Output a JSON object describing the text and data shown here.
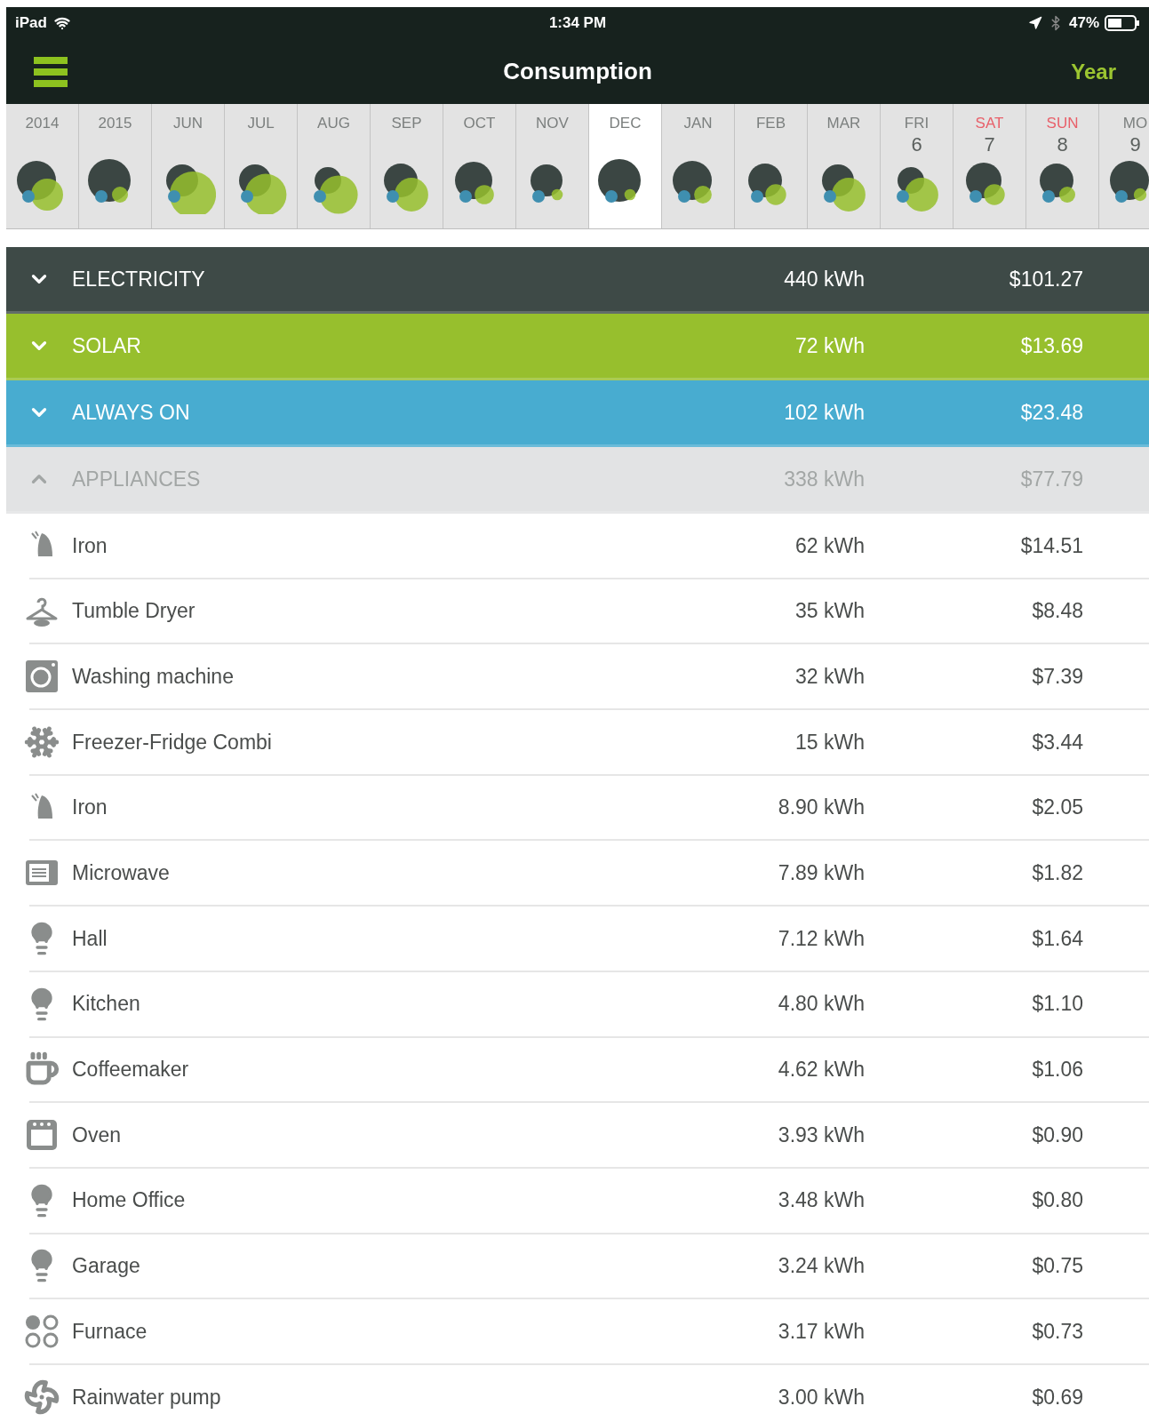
{
  "status_bar": {
    "device": "iPad",
    "time": "1:34 PM",
    "battery": "47%"
  },
  "header": {
    "title": "Consumption",
    "period": "Year"
  },
  "timeline": [
    {
      "label": "2014",
      "selected": false,
      "weekend": false
    },
    {
      "label": "2015",
      "selected": false,
      "weekend": false
    },
    {
      "label": "JUN",
      "selected": false,
      "weekend": false
    },
    {
      "label": "JUL",
      "selected": false,
      "weekend": false
    },
    {
      "label": "AUG",
      "selected": false,
      "weekend": false
    },
    {
      "label": "SEP",
      "selected": false,
      "weekend": false
    },
    {
      "label": "OCT",
      "selected": false,
      "weekend": false
    },
    {
      "label": "NOV",
      "selected": false,
      "weekend": false
    },
    {
      "label": "DEC",
      "selected": true,
      "weekend": false
    },
    {
      "label": "JAN",
      "selected": false,
      "weekend": false
    },
    {
      "label": "FEB",
      "selected": false,
      "weekend": false
    },
    {
      "label": "MAR",
      "selected": false,
      "weekend": false
    },
    {
      "label": "FRI",
      "day": "6",
      "selected": false,
      "weekend": false
    },
    {
      "label": "SAT",
      "day": "7",
      "selected": false,
      "weekend": true
    },
    {
      "label": "SUN",
      "day": "8",
      "selected": false,
      "weekend": true
    },
    {
      "label": "MO",
      "day": "9",
      "selected": false,
      "weekend": false
    }
  ],
  "categories": [
    {
      "label": "ELECTRICITY",
      "energy": "440 kWh",
      "cost": "$101.27",
      "color": "#3e4a47",
      "expanded": false
    },
    {
      "label": "SOLAR",
      "energy": "72 kWh",
      "cost": "$13.69",
      "color": "#97bf2d",
      "expanded": false
    },
    {
      "label": "ALWAYS ON",
      "energy": "102 kWh",
      "cost": "$23.48",
      "color": "#48acd0",
      "expanded": false
    },
    {
      "label": "APPLIANCES",
      "energy": "338 kWh",
      "cost": "$77.79",
      "color": "#e2e3e4",
      "expanded": true
    }
  ],
  "appliances": [
    {
      "kind": "iron",
      "name": "Iron",
      "energy": "62 kWh",
      "cost": "$14.51"
    },
    {
      "kind": "hanger",
      "name": "Tumble Dryer",
      "energy": "35 kWh",
      "cost": "$8.48"
    },
    {
      "kind": "washer",
      "name": "Washing machine",
      "energy": "32 kWh",
      "cost": "$7.39"
    },
    {
      "kind": "snowflake",
      "name": "Freezer-Fridge Combi",
      "energy": "15 kWh",
      "cost": "$3.44"
    },
    {
      "kind": "iron",
      "name": "Iron",
      "energy": "8.90 kWh",
      "cost": "$2.05"
    },
    {
      "kind": "microwave",
      "name": "Microwave",
      "energy": "7.89 kWh",
      "cost": "$1.82"
    },
    {
      "kind": "bulb",
      "name": "Hall",
      "energy": "7.12 kWh",
      "cost": "$1.64"
    },
    {
      "kind": "bulb",
      "name": "Kitchen",
      "energy": "4.80 kWh",
      "cost": "$1.10"
    },
    {
      "kind": "cup",
      "name": "Coffeemaker",
      "energy": "4.62 kWh",
      "cost": "$1.06"
    },
    {
      "kind": "oven",
      "name": "Oven",
      "energy": "3.93 kWh",
      "cost": "$0.90"
    },
    {
      "kind": "bulb",
      "name": "Home Office",
      "energy": "3.48 kWh",
      "cost": "$0.80"
    },
    {
      "kind": "bulb",
      "name": "Garage",
      "energy": "3.24 kWh",
      "cost": "$0.75"
    },
    {
      "kind": "burners",
      "name": "Furnace",
      "energy": "3.17 kWh",
      "cost": "$0.73"
    },
    {
      "kind": "pump",
      "name": "Rainwater pump",
      "energy": "3.00 kWh",
      "cost": "$0.69"
    }
  ]
}
